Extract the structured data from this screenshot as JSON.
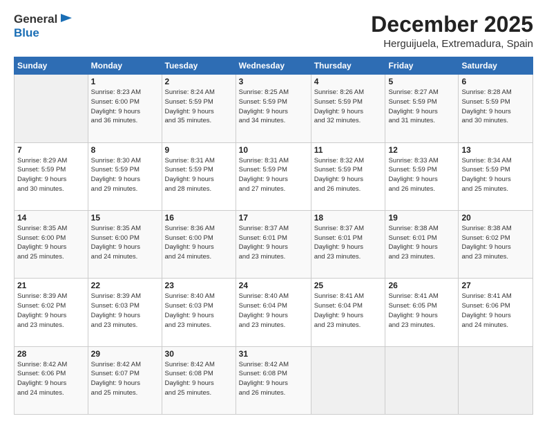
{
  "logo": {
    "general": "General",
    "blue": "Blue"
  },
  "header": {
    "month_title": "December 2025",
    "location": "Herguijuela, Extremadura, Spain"
  },
  "days_of_week": [
    "Sunday",
    "Monday",
    "Tuesday",
    "Wednesday",
    "Thursday",
    "Friday",
    "Saturday"
  ],
  "weeks": [
    [
      {
        "day": "",
        "info": ""
      },
      {
        "day": "1",
        "info": "Sunrise: 8:23 AM\nSunset: 6:00 PM\nDaylight: 9 hours\nand 36 minutes."
      },
      {
        "day": "2",
        "info": "Sunrise: 8:24 AM\nSunset: 5:59 PM\nDaylight: 9 hours\nand 35 minutes."
      },
      {
        "day": "3",
        "info": "Sunrise: 8:25 AM\nSunset: 5:59 PM\nDaylight: 9 hours\nand 34 minutes."
      },
      {
        "day": "4",
        "info": "Sunrise: 8:26 AM\nSunset: 5:59 PM\nDaylight: 9 hours\nand 32 minutes."
      },
      {
        "day": "5",
        "info": "Sunrise: 8:27 AM\nSunset: 5:59 PM\nDaylight: 9 hours\nand 31 minutes."
      },
      {
        "day": "6",
        "info": "Sunrise: 8:28 AM\nSunset: 5:59 PM\nDaylight: 9 hours\nand 30 minutes."
      }
    ],
    [
      {
        "day": "7",
        "info": "Sunrise: 8:29 AM\nSunset: 5:59 PM\nDaylight: 9 hours\nand 30 minutes."
      },
      {
        "day": "8",
        "info": "Sunrise: 8:30 AM\nSunset: 5:59 PM\nDaylight: 9 hours\nand 29 minutes."
      },
      {
        "day": "9",
        "info": "Sunrise: 8:31 AM\nSunset: 5:59 PM\nDaylight: 9 hours\nand 28 minutes."
      },
      {
        "day": "10",
        "info": "Sunrise: 8:31 AM\nSunset: 5:59 PM\nDaylight: 9 hours\nand 27 minutes."
      },
      {
        "day": "11",
        "info": "Sunrise: 8:32 AM\nSunset: 5:59 PM\nDaylight: 9 hours\nand 26 minutes."
      },
      {
        "day": "12",
        "info": "Sunrise: 8:33 AM\nSunset: 5:59 PM\nDaylight: 9 hours\nand 26 minutes."
      },
      {
        "day": "13",
        "info": "Sunrise: 8:34 AM\nSunset: 5:59 PM\nDaylight: 9 hours\nand 25 minutes."
      }
    ],
    [
      {
        "day": "14",
        "info": "Sunrise: 8:35 AM\nSunset: 6:00 PM\nDaylight: 9 hours\nand 25 minutes."
      },
      {
        "day": "15",
        "info": "Sunrise: 8:35 AM\nSunset: 6:00 PM\nDaylight: 9 hours\nand 24 minutes."
      },
      {
        "day": "16",
        "info": "Sunrise: 8:36 AM\nSunset: 6:00 PM\nDaylight: 9 hours\nand 24 minutes."
      },
      {
        "day": "17",
        "info": "Sunrise: 8:37 AM\nSunset: 6:01 PM\nDaylight: 9 hours\nand 23 minutes."
      },
      {
        "day": "18",
        "info": "Sunrise: 8:37 AM\nSunset: 6:01 PM\nDaylight: 9 hours\nand 23 minutes."
      },
      {
        "day": "19",
        "info": "Sunrise: 8:38 AM\nSunset: 6:01 PM\nDaylight: 9 hours\nand 23 minutes."
      },
      {
        "day": "20",
        "info": "Sunrise: 8:38 AM\nSunset: 6:02 PM\nDaylight: 9 hours\nand 23 minutes."
      }
    ],
    [
      {
        "day": "21",
        "info": "Sunrise: 8:39 AM\nSunset: 6:02 PM\nDaylight: 9 hours\nand 23 minutes."
      },
      {
        "day": "22",
        "info": "Sunrise: 8:39 AM\nSunset: 6:03 PM\nDaylight: 9 hours\nand 23 minutes."
      },
      {
        "day": "23",
        "info": "Sunrise: 8:40 AM\nSunset: 6:03 PM\nDaylight: 9 hours\nand 23 minutes."
      },
      {
        "day": "24",
        "info": "Sunrise: 8:40 AM\nSunset: 6:04 PM\nDaylight: 9 hours\nand 23 minutes."
      },
      {
        "day": "25",
        "info": "Sunrise: 8:41 AM\nSunset: 6:04 PM\nDaylight: 9 hours\nand 23 minutes."
      },
      {
        "day": "26",
        "info": "Sunrise: 8:41 AM\nSunset: 6:05 PM\nDaylight: 9 hours\nand 23 minutes."
      },
      {
        "day": "27",
        "info": "Sunrise: 8:41 AM\nSunset: 6:06 PM\nDaylight: 9 hours\nand 24 minutes."
      }
    ],
    [
      {
        "day": "28",
        "info": "Sunrise: 8:42 AM\nSunset: 6:06 PM\nDaylight: 9 hours\nand 24 minutes."
      },
      {
        "day": "29",
        "info": "Sunrise: 8:42 AM\nSunset: 6:07 PM\nDaylight: 9 hours\nand 25 minutes."
      },
      {
        "day": "30",
        "info": "Sunrise: 8:42 AM\nSunset: 6:08 PM\nDaylight: 9 hours\nand 25 minutes."
      },
      {
        "day": "31",
        "info": "Sunrise: 8:42 AM\nSunset: 6:08 PM\nDaylight: 9 hours\nand 26 minutes."
      },
      {
        "day": "",
        "info": ""
      },
      {
        "day": "",
        "info": ""
      },
      {
        "day": "",
        "info": ""
      }
    ]
  ]
}
